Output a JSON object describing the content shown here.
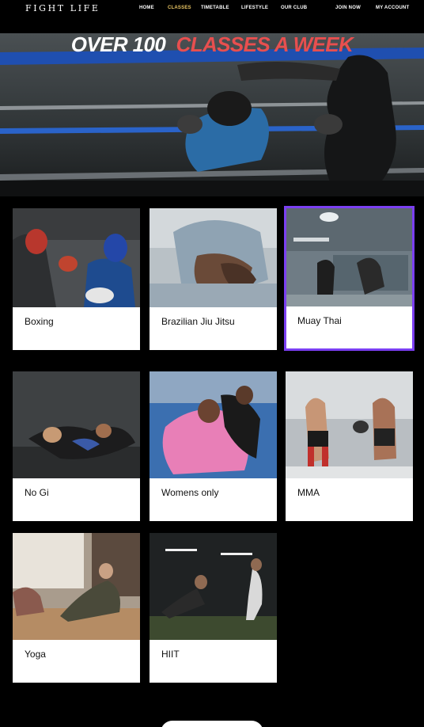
{
  "brand": {
    "logo": "FIGHT LIFE"
  },
  "nav": {
    "items": [
      {
        "label": "HOME"
      },
      {
        "label": "CLASSES"
      },
      {
        "label": "TIMETABLE"
      },
      {
        "label": "LIFESTYLE"
      },
      {
        "label": "OUR CLUB"
      }
    ],
    "join": "JOIN NOW",
    "account": "MY ACCOUNT",
    "active_color": "#e8c463"
  },
  "hero": {
    "title_part1": "OVER 100",
    "title_part2": "CLASSES A WEEK",
    "title_accent_color": "#e84f4f"
  },
  "classes": [
    {
      "label": "Boxing"
    },
    {
      "label": "Brazilian Jiu Jitsu"
    },
    {
      "label": "Muay Thai",
      "selected": true
    },
    {
      "label": "No Gi"
    },
    {
      "label": "Womens only"
    },
    {
      "label": "MMA"
    },
    {
      "label": "Yoga"
    },
    {
      "label": "HIIT"
    }
  ],
  "selection_color": "#7b3ff2"
}
